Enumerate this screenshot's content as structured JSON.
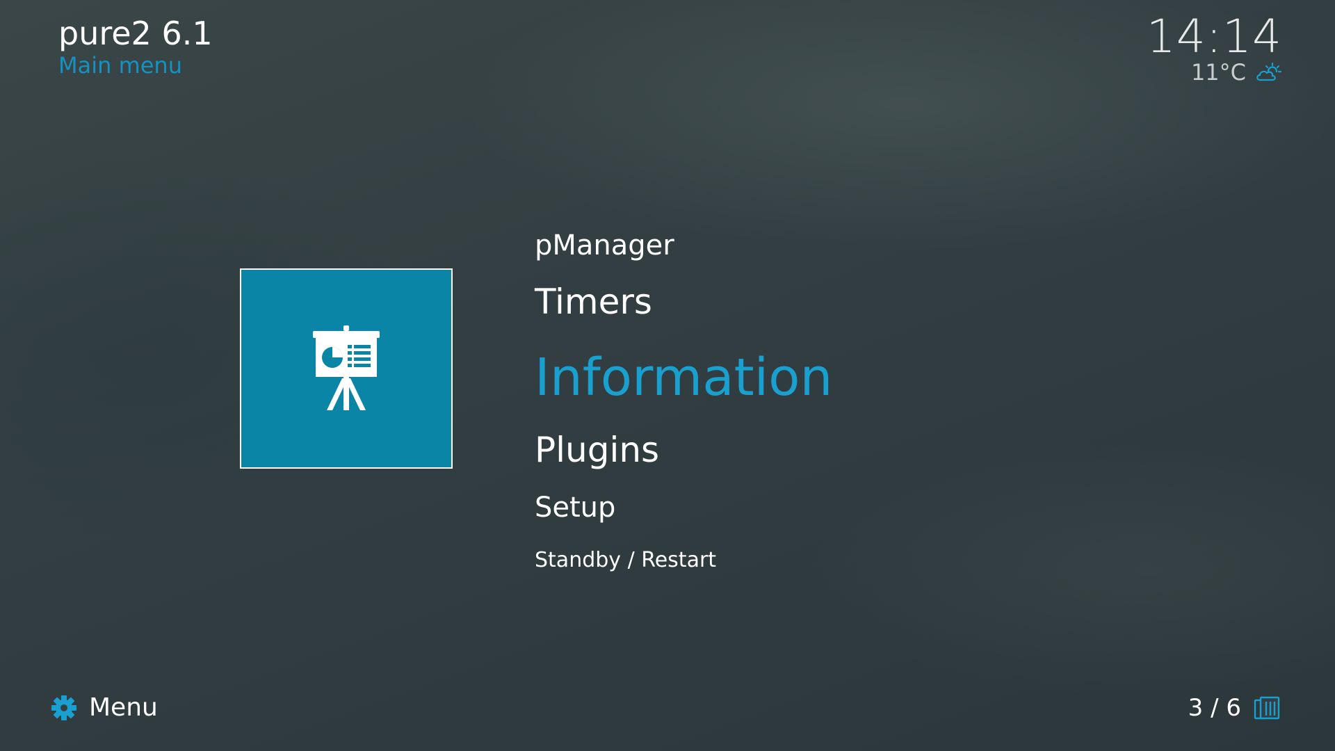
{
  "header": {
    "title": "pure2 6.1",
    "subtitle": "Main menu",
    "clock": "14:14",
    "temperature": "11°C",
    "weather_icon": "partly-cloudy-sun-icon"
  },
  "selected_tile": {
    "icon": "presentation-board-icon",
    "background": "#0b85a6"
  },
  "menu": {
    "items": [
      {
        "label": "pManager"
      },
      {
        "label": "Timers"
      },
      {
        "label": "Information",
        "selected": true
      },
      {
        "label": "Plugins"
      },
      {
        "label": "Setup"
      },
      {
        "label": "Standby / Restart"
      }
    ]
  },
  "footer": {
    "menu_label": "Menu",
    "menu_icon": "gear-icon",
    "page_indicator": "3 / 6",
    "page_icon": "pages-icon"
  },
  "colors": {
    "accent": "#1592c2",
    "selected_text": "#1aa0cf",
    "background": "#333f42"
  }
}
